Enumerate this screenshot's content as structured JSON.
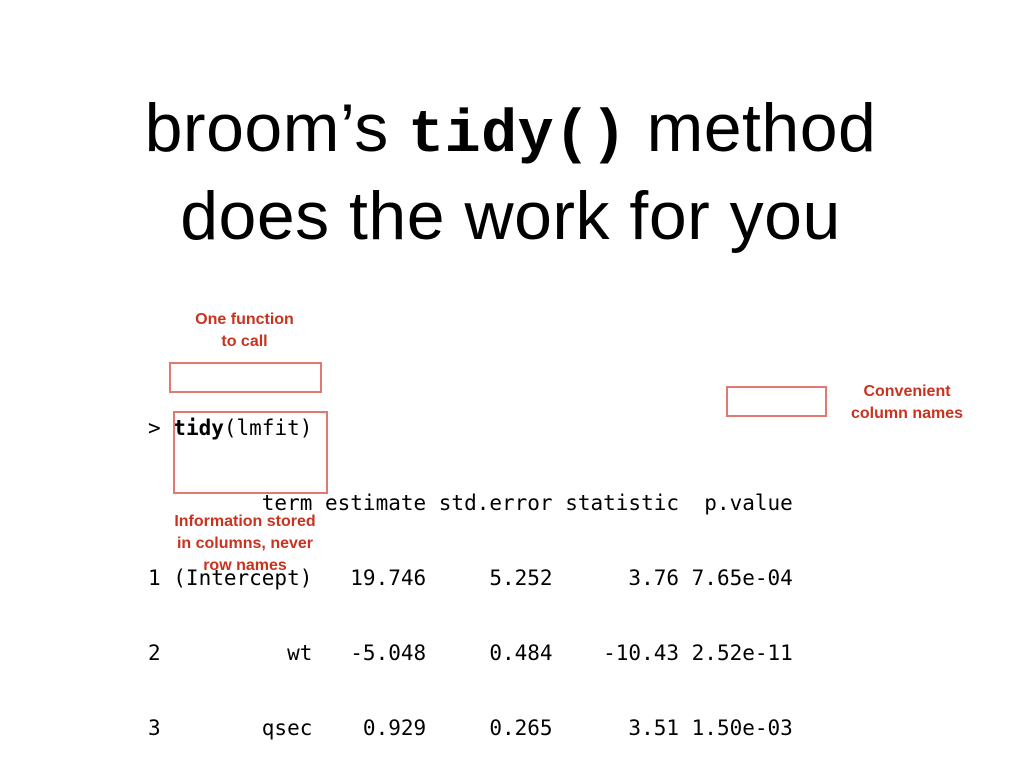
{
  "title": {
    "line1_pre": "broom’s ",
    "line1_code": "tidy()",
    "line1_post": " method",
    "line2": "does the work for you"
  },
  "annotations": {
    "function_call": "One function\nto call",
    "column_names": "Convenient\ncolumn names",
    "info_stored": "Information stored\nin columns, never\nrow names"
  },
  "console": {
    "prompt": "> ",
    "command_fn": "tidy",
    "command_args": "(lmfit)",
    "header": "         term estimate std.error statistic  p.value",
    "rows": [
      "1 (Intercept)   19.746     5.252      3.76 7.65e-04",
      "2          wt   -5.048     0.484    -10.43 2.52e-11",
      "3        qsec    0.929     0.265      3.51 1.50e-03"
    ]
  },
  "colors": {
    "annotation_text": "#c9321f",
    "box_border": "#e07a70"
  }
}
